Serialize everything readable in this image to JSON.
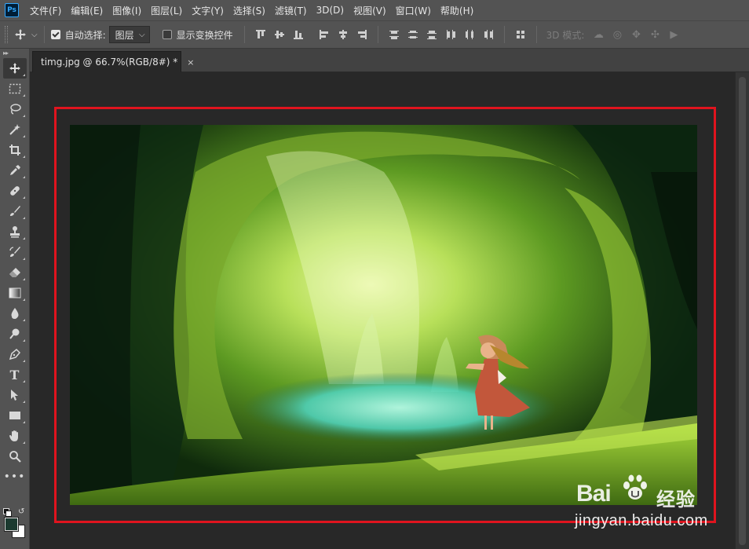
{
  "app": {
    "logo_text": "Ps"
  },
  "menu": {
    "items": [
      "文件(F)",
      "编辑(E)",
      "图像(I)",
      "图层(L)",
      "文字(Y)",
      "选择(S)",
      "滤镜(T)",
      "3D(D)",
      "视图(V)",
      "窗口(W)",
      "帮助(H)"
    ]
  },
  "options": {
    "auto_select_label": "自动选择:",
    "auto_select_checked": true,
    "target_value": "图层",
    "show_transform_label": "显示变换控件",
    "show_transform_checked": false,
    "mode_3d_label": "3D 模式:"
  },
  "toolbar": {
    "tools": [
      "move-tool",
      "marquee-tool",
      "lasso-tool",
      "magic-wand-tool",
      "crop-tool",
      "eyedropper-tool",
      "healing-brush-tool",
      "brush-tool",
      "clone-stamp-tool",
      "history-brush-tool",
      "eraser-tool",
      "gradient-tool",
      "blur-tool",
      "dodge-tool",
      "pen-tool",
      "type-tool",
      "path-selection-tool",
      "rectangle-tool",
      "hand-tool",
      "zoom-tool",
      "more-tools"
    ],
    "type_tool_glyph": "T",
    "foreground_color": "#1c3a30",
    "background_color": "#ffffff"
  },
  "document": {
    "tab_title": "timg.jpg @ 66.7%(RGB/8#) *",
    "close_glyph": "×"
  },
  "highlight_color": "#e0141e",
  "watermark": {
    "logo": "Bai",
    "logo_suffix": "经验",
    "url": "jingyan.baidu.com"
  }
}
